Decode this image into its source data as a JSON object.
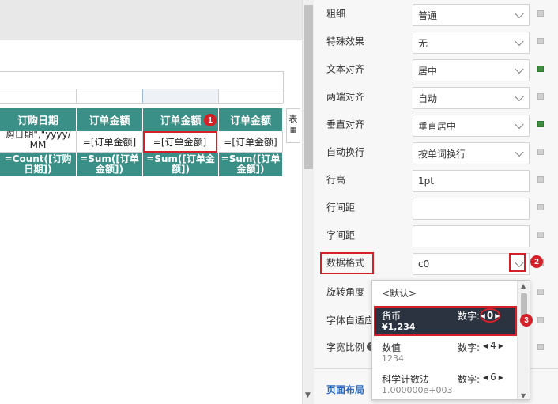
{
  "table": {
    "headers": [
      "订购日期",
      "订单金额",
      "订单金额",
      "订单金额"
    ],
    "detail": [
      "购日期\",\"yyyy/MM",
      "=[订单金额]",
      "=[订单金额]",
      "=[订单金额]"
    ],
    "footer": [
      "=Count([订购日期])",
      "=Sum([订单金额])",
      "=Sum([订单金额])",
      "=Sum([订单金额])"
    ],
    "side_tab": "表"
  },
  "annotations": {
    "badge1": "1",
    "badge2": "2",
    "badge3": "3"
  },
  "panel": {
    "rows": [
      {
        "label": "粗细",
        "value": "普通",
        "type": "select",
        "indicator": "off"
      },
      {
        "label": "特殊效果",
        "value": "无",
        "type": "select",
        "indicator": "off"
      },
      {
        "label": "文本对齐",
        "value": "居中",
        "type": "select",
        "indicator": "on"
      },
      {
        "label": "两端对齐",
        "value": "自动",
        "type": "select",
        "indicator": "off"
      },
      {
        "label": "垂直对齐",
        "value": "垂直居中",
        "type": "select",
        "indicator": "on"
      },
      {
        "label": "自动换行",
        "value": "按单词换行",
        "type": "select",
        "indicator": "off"
      },
      {
        "label": "行高",
        "value": "1pt",
        "type": "text",
        "indicator": "off"
      },
      {
        "label": "行间距",
        "value": "",
        "type": "text",
        "indicator": "off"
      },
      {
        "label": "字间距",
        "value": "",
        "type": "text",
        "indicator": "off"
      },
      {
        "label": "数据格式",
        "value": "c0",
        "type": "select",
        "indicator": "off"
      },
      {
        "label": "旋转角度",
        "value": "",
        "type": "none",
        "indicator": "off"
      },
      {
        "label": "字体自适应",
        "value": "",
        "type": "none",
        "indicator": "off"
      },
      {
        "label": "字宽比例",
        "value": "",
        "type": "none",
        "indicator": "off"
      }
    ],
    "section_title": "页面布局"
  },
  "dropdown": {
    "default_option": "<默认>",
    "digits_label": "数字:",
    "options": [
      {
        "name": "货币",
        "example": "¥1,234",
        "digits": "0",
        "selected": true
      },
      {
        "name": "数值",
        "example": "1234",
        "digits": "4",
        "selected": false
      },
      {
        "name": "科学计数法",
        "example": "1.000000e+003",
        "digits": "6",
        "selected": false
      }
    ]
  },
  "colors": {
    "table_header_bg": "#3a8f86",
    "highlight_red": "#d32029",
    "active_option_bg": "#2c3340",
    "indicator_on": "#3e8e41"
  }
}
